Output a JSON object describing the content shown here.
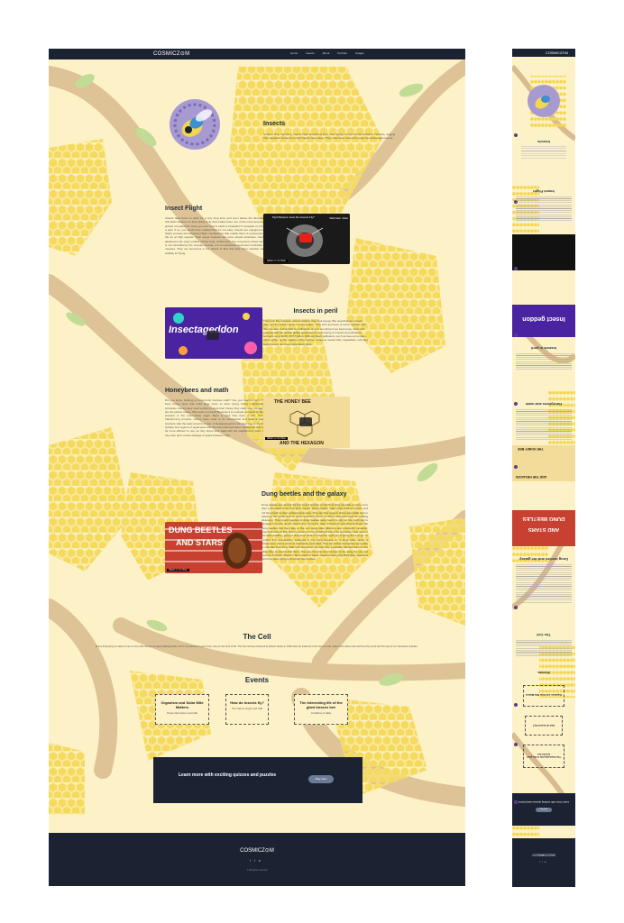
{
  "brand": {
    "logo": "COSMICZ⊙M",
    "mobile_logo": "COSMICZ⊙M"
  },
  "nav": [
    "Home",
    "Insects",
    "About",
    "Puzzles",
    "Images"
  ],
  "sections": {
    "insects": {
      "title": "Insects",
      "text": "Small or blue, night bug, insects have fascinating lives, their legacy covers colorful collective behavior, ranging from beautiful monarchs to their frantic insect bees. They have been around for quite the substantial amount."
    },
    "flight": {
      "title": "Insect Flight",
      "text": "Insects have lived on earth for a very long time, and even before the dinosaurs. Scientists believe it is their ability to fly that makes them one of the most successful groups of organisms. Have you ever tried to catch a mosquito? A mosquito or a fly is a pest. If so, you would have realised that it's not easy. Insects are equipped with highly evolved and advanced flight mechanisms that enable them to manoeuvre in the air at high speeds. Their wings however are more simple structures, hence, attached to the outer surface of their body. Unlike birds, the movement of their wings is not controlled by the muscles outside, it is a mechanical movement controlled by muscles. They are structures in the thorax of flies that help them maintain wing stability for flying.",
      "video_title": "Myth Busters: How Do Insects Fly?",
      "video_share": "Share",
      "video_later": "Watch later",
      "video_watch": "Watch on YouTube"
    },
    "peril": {
      "title": "Insects in peril",
      "text": "They look like nuisance and sometimes they look creepy. But nevertheless, insects play very important role on our ecosystem. They can't just bees or some squirrels. But they are also responsible for pollination of over one third of our food crops. Scientists estimate that the annual global production of food relying on insects as pollinators amounts up to $235 - $577 billion. Without insect pollinators, such as bees and potato, moths suffer, as the majority of the food we consume needs fruits, vegetables, nuts and legumes and are insect pollinated plants.",
      "video_title": "Insectageddon",
      "video_caption": "Insectageddon"
    },
    "honey": {
      "title": "Honeybees and math",
      "text": "Did you know, building a honeycomb involves math? Yes, you heard it right. The busy honey bees that build large hives to store honey follow mathematical principles. Honey bees need a place to store their honey, they make wax. Hexagons are the perfect shape. Why such a curved? Because it is a simple connectivity. Bees produce in the surrounding sugar. Bees in their hive have a wax energy transforming process. Honey bees need to be economical and build a stable structure with the least amount of wax. A hexagonal grid is the best way to divide a surface into regions of equal area with the least total perimeter. Hexagonal cells are far more efficient to use, as they share their walls with the neighbouring cells, but they also don't create wastage of space between cells.",
      "video_title": "The Honey Bee And The Hexagon",
      "video_top": "THE HONEY BEE",
      "video_bottom": "AND THE HEXAGON",
      "video_watch": "Watch on YouTube"
    },
    "dung": {
      "title": "Dung beetles and the galaxy",
      "text": "Dung beetles are among the few insect species on Earth as they are able to carry more than a thousand times their body weight. Dung beetles make large balls of manure and roll them back to their underground nests. They lay their eggs in these dung balls and on hatching, the larvae feed on dung. Scientists found it in 2013, scientists made an exciting discovery. They found species of dung beetles were found to rely on the night sky to navigate their way as we know them. Using the stars, Previously scientists believed that dung beetles find their way to the sun using solar direction and moonlight. However, scientists noticed that their movement is not prohibited when the orientation was done in overcast weather, giving a clue as to what it is that the night sky is giving them to go. To confirm this, researchers scattered a tiny dung beetles on a large table under a planetarium, with a dome of electrically controlled. They found that the beetles were able to maintain their dung balls with respect to the night sky, especially the light band in the Milky Way, is used to find them. They are the only insect known to be using the sun and moon to find their direction. But reward of these creatures using the Milky Way, scientists said they were trying to find their own homes.",
      "video_top": "DUNG BEETLES",
      "video_bottom": "AND STARS",
      "video_watch": "Watch on YouTube"
    }
  },
  "cell": {
    "title": "The Cell",
    "text": "Every living thing is made of one or more cells that are its basic building blocks. From tiny bacteria to giant trees, they do the work of life. The first cell was observed by Robert Hooke in 1665 when he looked at a thin slice of cork. Learn more about cells and how they work with the help of our interactive modules."
  },
  "events": {
    "title": "Events",
    "items": [
      {
        "title": "Organism and Solar Mite Matters",
        "sub": "Panel discussion and talk"
      },
      {
        "title": "How do insects fly?",
        "sub": "The Sense Night and Talk"
      },
      {
        "title": "The Interesting life of the giant bosses bee",
        "sub": "Amaflora of talks"
      }
    ]
  },
  "cta": {
    "text": "Learn more with exciting quizzes and puzzles",
    "button": "Play Now"
  },
  "footer": {
    "copyright": "© All rights reserved"
  },
  "mobile": {
    "insects_title": "Insects",
    "flight_title": "Insect Flight",
    "peril_title": "Insects in peril",
    "honey_title": "Honeybees and math",
    "dung_title": "Dung beetles and the galaxy",
    "cell_title": "The Cell",
    "events_title": "Events",
    "ev1": "Organism and Solar Mite Matters",
    "ev2": "How do insects fly?",
    "ev3": "The Interesting life of the giant bosses bee",
    "cta": "Learn more with exciting quizzes and puzzles",
    "button": "Play Now",
    "peril_banner": "Insect geddon",
    "honey_top": "THE HONEY BEE",
    "honey_bottom": "AND THE HEXAGON",
    "dung_top": "DUNG BEETLES",
    "dung_bottom": "AND STARS"
  },
  "colors": {
    "navy": "#1b2333",
    "cream": "#fdf1c8",
    "honey": "#f4d64c",
    "branch": "#d6b98c",
    "leaf": "#b8d98e"
  }
}
